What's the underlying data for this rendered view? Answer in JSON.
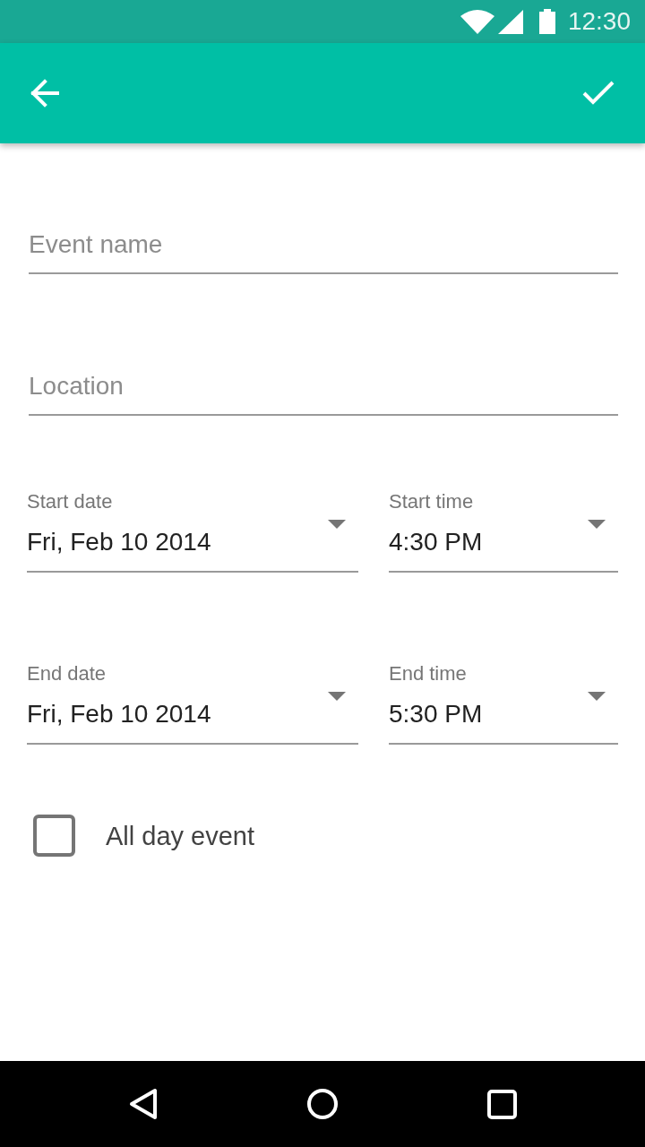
{
  "status_bar": {
    "time": "12:30"
  },
  "form": {
    "text_fields": [
      {
        "placeholder": "Event name"
      },
      {
        "placeholder": "Location"
      }
    ],
    "date_time_rows": [
      {
        "date": {
          "label": "Start date",
          "value": "Fri, Feb 10 2014"
        },
        "time": {
          "label": "Start time",
          "value": "4:30 PM"
        }
      },
      {
        "date": {
          "label": "End date",
          "value": "Fri, Feb 10 2014"
        },
        "time": {
          "label": "End time",
          "value": "5:30 PM"
        }
      }
    ],
    "all_day": {
      "label": "All day event",
      "checked": false
    }
  }
}
